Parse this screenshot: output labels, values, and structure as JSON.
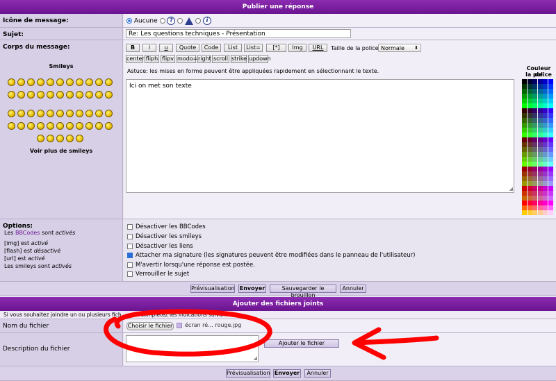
{
  "header": {
    "title": "Publier une réponse"
  },
  "icon_row": {
    "label": "Icône de message:",
    "none_label": "Aucune",
    "icons": [
      "question-icon",
      "warning-icon",
      "info-icon"
    ]
  },
  "subject_row": {
    "label": "Sujet:",
    "value": "Re: Les questions techniques - Présentation"
  },
  "body_row": {
    "label": "Corps du message:",
    "smileys_title": "Smileys",
    "more_smileys": "Voir plus de smileys",
    "toolbar": [
      "B",
      "i",
      "u",
      "Quote",
      "Code",
      "List",
      "List=",
      "[*]",
      "Img",
      "URL"
    ],
    "toolbar2": [
      "center",
      "fliph",
      "flipv",
      "modo=",
      "right",
      "scroll",
      "strike",
      "updown"
    ],
    "font_size_label": "Taille de la police:",
    "font_size_value": "Normale",
    "hint": "Astuce: les mises en forme peuvent être appliquées rapidement en sélectionnant le texte.",
    "message_text": "Ici on met son texte",
    "color_label_1": "Couleur de",
    "color_label_2": "la police"
  },
  "options": {
    "label": "Options:",
    "status": {
      "bbcodes_prefix": "Les",
      "bbcodes_link": "BBCodes",
      "bbcodes_mid": "sont",
      "bbcodes_state": "activés",
      "img_prefix": "[img]",
      "img_mid": "est",
      "img_state": "activé",
      "flash_prefix": "[flash]",
      "flash_mid": "est",
      "flash_state": "désactivé",
      "url_prefix": "[url]",
      "url_mid": "est",
      "url_state": "activé",
      "smileys_prefix": "Les smileys sont",
      "smileys_state": "activés"
    },
    "checkboxes": [
      {
        "label": "Désactiver les BBCodes",
        "checked": false
      },
      {
        "label": "Désactiver les smileys",
        "checked": false
      },
      {
        "label": "Désactiver les liens",
        "checked": false
      },
      {
        "label": "Attacher ma signature (les signatures peuvent être modifiées dans le panneau de l'utilisateur)",
        "checked": true
      },
      {
        "label": "M'avertir lorsqu'une réponse est postée.",
        "checked": false
      },
      {
        "label": "Verrouiller le sujet",
        "checked": false
      }
    ]
  },
  "actions": {
    "preview": "Prévisualisation",
    "send": "Envoyer",
    "save_draft": "Sauvegarder le brouillon",
    "cancel": "Annuler"
  },
  "attachments": {
    "title": "Ajouter des fichiers joints",
    "info_start": "Si vous souhaitez joindre un ou plusieurs fich",
    "info_end": "complétez les indications suivantes.",
    "filename_label": "Nom du fichier",
    "choose_button": "Choisir le fichier",
    "chosen_file": "écran ré... rouge.jpg",
    "description_label": "Description du fichier",
    "add_button": "Ajouter le fichier"
  },
  "bottom_actions": {
    "preview": "Prévisualisation",
    "send": "Envoyer",
    "cancel": "Annuler"
  }
}
